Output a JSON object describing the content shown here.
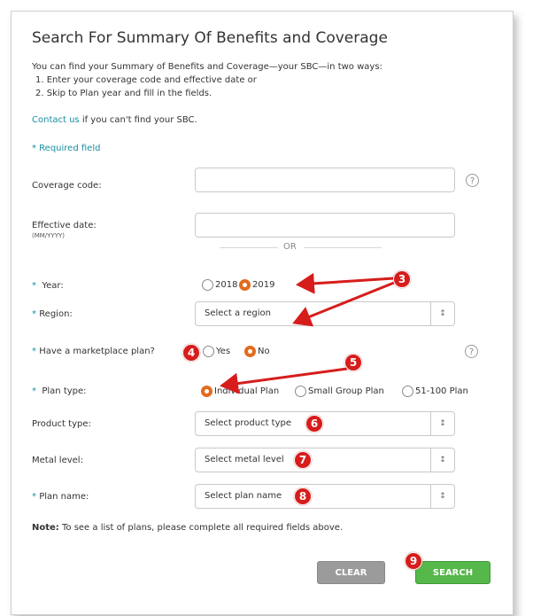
{
  "page": {
    "title": "Search For Summary Of Benefits and Coverage",
    "intro": "You can find your Summary of Benefits and Coverage—your SBC—in two ways:",
    "steps": [
      "1.  Enter your coverage code and effective date or",
      "2.  Skip to Plan year and fill in the fields."
    ],
    "contact_link": "Contact us",
    "contact_rest": " if you can't find your SBC.",
    "required_note": "* Required field"
  },
  "form": {
    "coverage_code_label": "Coverage code:",
    "coverage_code_value": "",
    "effective_date_label": "Effective date:",
    "effective_date_hint": "(MM/YYYY)",
    "effective_date_value": "",
    "or_text": "OR",
    "year_label": "Year:",
    "year_options": [
      "2018",
      "2019"
    ],
    "year_selected": "2019",
    "region_label": "Region:",
    "region_value": "Select a region",
    "marketplace_label": "Have a marketplace plan?",
    "marketplace_options": [
      "Yes",
      "No"
    ],
    "marketplace_selected": "No",
    "plan_type_label": "Plan type:",
    "plan_type_options": [
      "Individual Plan",
      "Small Group Plan",
      "51-100 Plan"
    ],
    "plan_type_selected": "Individual Plan",
    "product_type_label": "Product type:",
    "product_type_value": "Select product type",
    "metal_level_label": "Metal level:",
    "metal_level_value": "Select metal level",
    "plan_name_label": "Plan name:",
    "plan_name_value": "Select plan name",
    "note_bold": "Note:",
    "note_text": " To see a list of plans, please complete all required fields above.",
    "help_glyph": "?",
    "select_arrow_glyph": "↕"
  },
  "buttons": {
    "clear": "CLEAR",
    "search": "SEARCH"
  },
  "callouts": [
    "3",
    "4",
    "5",
    "6",
    "7",
    "8",
    "9"
  ],
  "colors": {
    "accent_teal": "#1a8fa0",
    "radio_selected": "#e36b1e",
    "search_green": "#56b84b",
    "clear_gray": "#9b9b9b",
    "callout_red": "#d71c1c"
  }
}
